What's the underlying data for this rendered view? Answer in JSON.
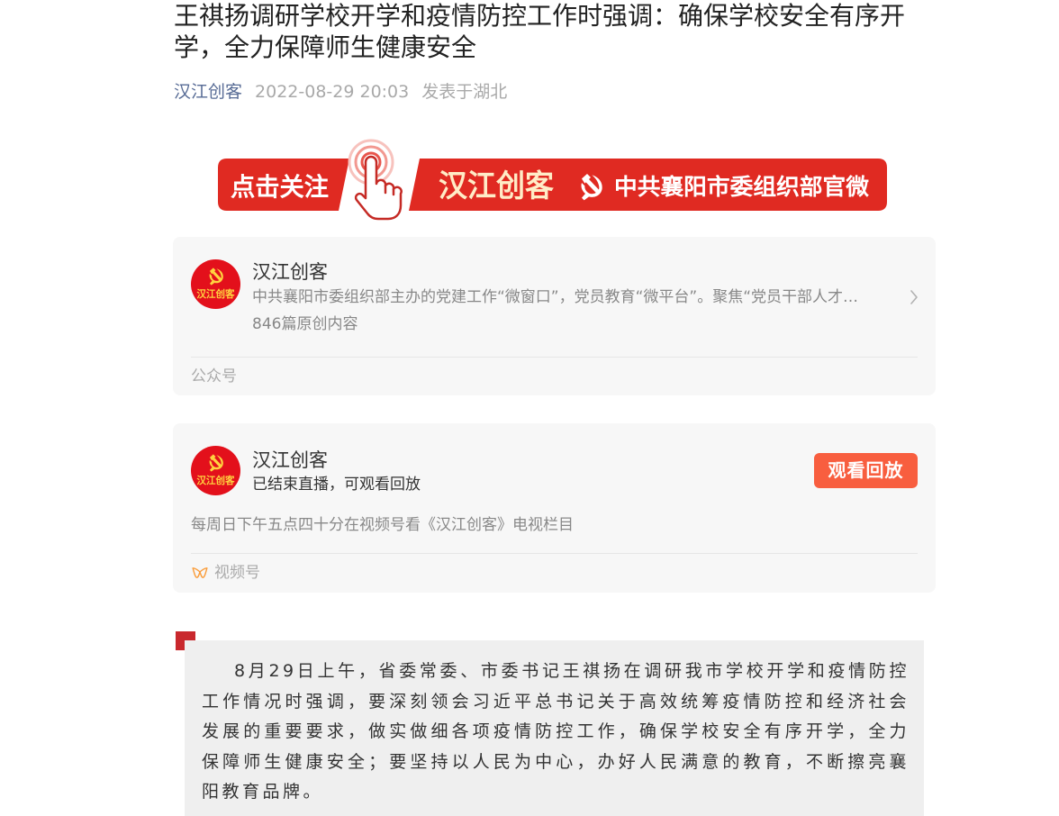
{
  "article": {
    "title": "王祺扬调研学校开学和疫情防控工作时强调：确保学校安全有序开学，全力保障师生健康安全",
    "meta": {
      "account_name": "汉江创客",
      "publish_time": "2022-08-29 20:03",
      "location": "发表于湖北"
    }
  },
  "banner": {
    "follow_text": "点击关注",
    "brand_text": "汉江创客",
    "org_text": "中共襄阳市委组织部官微",
    "icons": {
      "tap": "hand-tap-icon",
      "emblem": "party-emblem-icon"
    }
  },
  "official_account_card": {
    "avatar_text": "汉江创客",
    "name": "汉江创客",
    "description": "中共襄阳市委组织部主办的党建工作“微窗口”，党员教育“微平台”。聚焦“党员干部人才…",
    "original_count": "846篇原创内容",
    "type_label": "公众号",
    "icons": {
      "avatar_emblem": "party-emblem-icon",
      "open": "chevron-right-icon"
    }
  },
  "channels_card": {
    "avatar_text": "汉江创客",
    "name": "汉江创客",
    "live_status": "已结束直播，可观看回放",
    "replay_button": "观看回放",
    "schedule": "每周日下午五点四十分在视频号看《汉江创客》电视栏目",
    "type_label": "视频号",
    "icons": {
      "avatar_emblem": "party-emblem-icon",
      "channels": "channels-icon"
    }
  },
  "quote_block": {
    "paragraph": "8月29日上午，省委常委、市委书记王祺扬在调研我市学校开学和疫情防控工作情况时强调，要深刻领会习近平总书记关于高效统筹疫情防控和经济社会发展的重要要求，做实做细各项疫情防控工作，确保学校安全有序开学，全力保障师生健康安全；要坚持以人民为中心，办好人民满意的教育，不断擦亮襄阳教育品牌。"
  },
  "theme": {
    "link_color": "#576b95",
    "brand_red": "#e02a22",
    "banner_brand_text": "#ffecc7",
    "avatar_red": "#e3101b",
    "avatar_gold": "#ffd23f",
    "replay_button": "#f85e3f",
    "channels_icon": "#fa9d3b",
    "quote_accent": "#c9282d",
    "card_background": "#f7f7f7",
    "quote_background": "#efefef"
  }
}
